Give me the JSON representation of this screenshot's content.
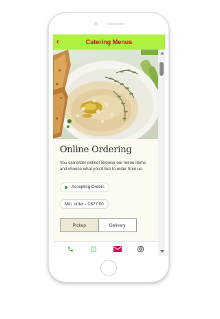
{
  "header": {
    "title": "Catering Menus",
    "back_glyph": "‹"
  },
  "ordering": {
    "title": "Online Ordering",
    "description": "You can order online! Browse our menu items and choose what you'd like to order from us.",
    "status": "Accepting Orders",
    "min_order": "Min. order - C$77.00",
    "tabs": [
      "Pickup",
      "Delivery"
    ],
    "active_tab": "Pickup"
  },
  "bottom_bar": {
    "icons": [
      "phone-icon",
      "whatsapp-icon",
      "mail-icon",
      "instagram-icon"
    ]
  },
  "colors": {
    "header_bg": "#aef141",
    "header_text": "#e0001b",
    "status_dot": "#28a745",
    "phone_icon": "#2e9e3e",
    "whatsapp_icon": "#25d366",
    "mail_icon": "#c2185b"
  }
}
